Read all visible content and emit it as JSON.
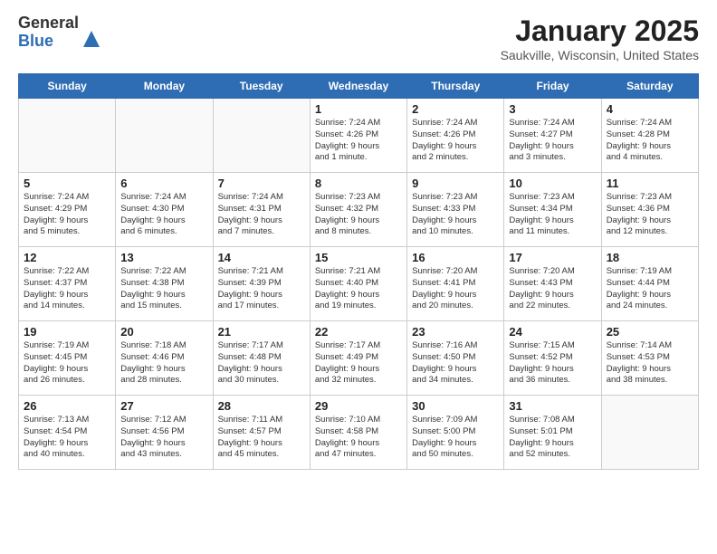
{
  "header": {
    "logo_general": "General",
    "logo_blue": "Blue",
    "month_title": "January 2025",
    "location": "Saukville, Wisconsin, United States"
  },
  "days_of_week": [
    "Sunday",
    "Monday",
    "Tuesday",
    "Wednesday",
    "Thursday",
    "Friday",
    "Saturday"
  ],
  "weeks": [
    [
      {
        "day": "",
        "info": ""
      },
      {
        "day": "",
        "info": ""
      },
      {
        "day": "",
        "info": ""
      },
      {
        "day": "1",
        "info": "Sunrise: 7:24 AM\nSunset: 4:26 PM\nDaylight: 9 hours\nand 1 minute."
      },
      {
        "day": "2",
        "info": "Sunrise: 7:24 AM\nSunset: 4:26 PM\nDaylight: 9 hours\nand 2 minutes."
      },
      {
        "day": "3",
        "info": "Sunrise: 7:24 AM\nSunset: 4:27 PM\nDaylight: 9 hours\nand 3 minutes."
      },
      {
        "day": "4",
        "info": "Sunrise: 7:24 AM\nSunset: 4:28 PM\nDaylight: 9 hours\nand 4 minutes."
      }
    ],
    [
      {
        "day": "5",
        "info": "Sunrise: 7:24 AM\nSunset: 4:29 PM\nDaylight: 9 hours\nand 5 minutes."
      },
      {
        "day": "6",
        "info": "Sunrise: 7:24 AM\nSunset: 4:30 PM\nDaylight: 9 hours\nand 6 minutes."
      },
      {
        "day": "7",
        "info": "Sunrise: 7:24 AM\nSunset: 4:31 PM\nDaylight: 9 hours\nand 7 minutes."
      },
      {
        "day": "8",
        "info": "Sunrise: 7:23 AM\nSunset: 4:32 PM\nDaylight: 9 hours\nand 8 minutes."
      },
      {
        "day": "9",
        "info": "Sunrise: 7:23 AM\nSunset: 4:33 PM\nDaylight: 9 hours\nand 10 minutes."
      },
      {
        "day": "10",
        "info": "Sunrise: 7:23 AM\nSunset: 4:34 PM\nDaylight: 9 hours\nand 11 minutes."
      },
      {
        "day": "11",
        "info": "Sunrise: 7:23 AM\nSunset: 4:36 PM\nDaylight: 9 hours\nand 12 minutes."
      }
    ],
    [
      {
        "day": "12",
        "info": "Sunrise: 7:22 AM\nSunset: 4:37 PM\nDaylight: 9 hours\nand 14 minutes."
      },
      {
        "day": "13",
        "info": "Sunrise: 7:22 AM\nSunset: 4:38 PM\nDaylight: 9 hours\nand 15 minutes."
      },
      {
        "day": "14",
        "info": "Sunrise: 7:21 AM\nSunset: 4:39 PM\nDaylight: 9 hours\nand 17 minutes."
      },
      {
        "day": "15",
        "info": "Sunrise: 7:21 AM\nSunset: 4:40 PM\nDaylight: 9 hours\nand 19 minutes."
      },
      {
        "day": "16",
        "info": "Sunrise: 7:20 AM\nSunset: 4:41 PM\nDaylight: 9 hours\nand 20 minutes."
      },
      {
        "day": "17",
        "info": "Sunrise: 7:20 AM\nSunset: 4:43 PM\nDaylight: 9 hours\nand 22 minutes."
      },
      {
        "day": "18",
        "info": "Sunrise: 7:19 AM\nSunset: 4:44 PM\nDaylight: 9 hours\nand 24 minutes."
      }
    ],
    [
      {
        "day": "19",
        "info": "Sunrise: 7:19 AM\nSunset: 4:45 PM\nDaylight: 9 hours\nand 26 minutes."
      },
      {
        "day": "20",
        "info": "Sunrise: 7:18 AM\nSunset: 4:46 PM\nDaylight: 9 hours\nand 28 minutes."
      },
      {
        "day": "21",
        "info": "Sunrise: 7:17 AM\nSunset: 4:48 PM\nDaylight: 9 hours\nand 30 minutes."
      },
      {
        "day": "22",
        "info": "Sunrise: 7:17 AM\nSunset: 4:49 PM\nDaylight: 9 hours\nand 32 minutes."
      },
      {
        "day": "23",
        "info": "Sunrise: 7:16 AM\nSunset: 4:50 PM\nDaylight: 9 hours\nand 34 minutes."
      },
      {
        "day": "24",
        "info": "Sunrise: 7:15 AM\nSunset: 4:52 PM\nDaylight: 9 hours\nand 36 minutes."
      },
      {
        "day": "25",
        "info": "Sunrise: 7:14 AM\nSunset: 4:53 PM\nDaylight: 9 hours\nand 38 minutes."
      }
    ],
    [
      {
        "day": "26",
        "info": "Sunrise: 7:13 AM\nSunset: 4:54 PM\nDaylight: 9 hours\nand 40 minutes."
      },
      {
        "day": "27",
        "info": "Sunrise: 7:12 AM\nSunset: 4:56 PM\nDaylight: 9 hours\nand 43 minutes."
      },
      {
        "day": "28",
        "info": "Sunrise: 7:11 AM\nSunset: 4:57 PM\nDaylight: 9 hours\nand 45 minutes."
      },
      {
        "day": "29",
        "info": "Sunrise: 7:10 AM\nSunset: 4:58 PM\nDaylight: 9 hours\nand 47 minutes."
      },
      {
        "day": "30",
        "info": "Sunrise: 7:09 AM\nSunset: 5:00 PM\nDaylight: 9 hours\nand 50 minutes."
      },
      {
        "day": "31",
        "info": "Sunrise: 7:08 AM\nSunset: 5:01 PM\nDaylight: 9 hours\nand 52 minutes."
      },
      {
        "day": "",
        "info": ""
      }
    ]
  ]
}
